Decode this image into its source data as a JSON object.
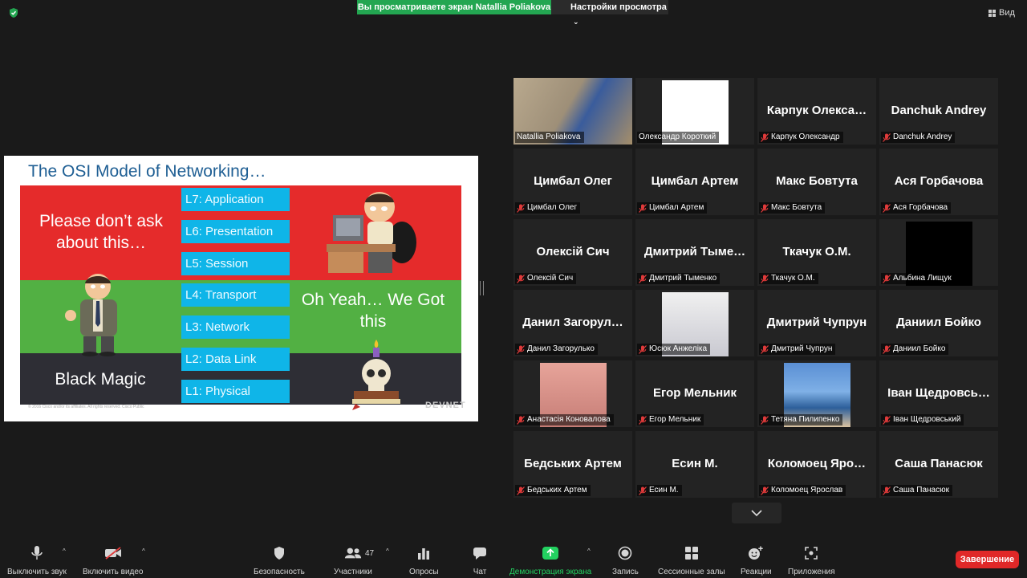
{
  "topbar": {
    "share_banner": "Вы просматриваете экран Natallia Poliakova",
    "view_settings": "Настройки просмотра",
    "view_button": "Вид"
  },
  "slide": {
    "title": "The OSI Model of Networking…",
    "ask_text": "Please don’t ask about this…",
    "yeah_text": "Oh Yeah… We Got this",
    "magic_text": "Black Magic",
    "layers": [
      "L7: Application",
      "L6: Presentation",
      "L5: Session",
      "L4: Transport",
      "L3: Network",
      "L2: Data Link",
      "L1: Physical"
    ],
    "footer": "© 2016 Cisco and/or its affiliates. All rights reserved. Cisco Public",
    "brand": "DEVNET"
  },
  "participants": [
    {
      "name": "",
      "label": "Natallia Poliakova",
      "muted": false,
      "image": "video",
      "active": true
    },
    {
      "name": "",
      "label": "Олександр Короткий",
      "muted": false,
      "image": "uni"
    },
    {
      "name": "Карпук Олекса…",
      "label": "Карпук Олександр",
      "muted": true
    },
    {
      "name": "Danchuk Andrey",
      "label": "Danchuk Andrey",
      "muted": true
    },
    {
      "name": "Цимбал Олег",
      "label": "Цимбал Олег",
      "muted": true
    },
    {
      "name": "Цимбал Артем",
      "label": "Цимбал Артем",
      "muted": true
    },
    {
      "name": "Макс Бовтута",
      "label": "Макс Бовтута",
      "muted": true
    },
    {
      "name": "Ася Горбачова",
      "label": "Ася Горбачова",
      "muted": true
    },
    {
      "name": "Олексій Сич",
      "label": "Олексій Сич",
      "muted": true
    },
    {
      "name": "Дмитрий Тыме…",
      "label": "Дмитрий Тыменко",
      "muted": true
    },
    {
      "name": "Ткачук О.М.",
      "label": "Ткачук О.М.",
      "muted": true
    },
    {
      "name": "",
      "label": "Альбина Лищук",
      "muted": true,
      "image": "black"
    },
    {
      "name": "Данил Загорул…",
      "label": "Данил Загорулько",
      "muted": true
    },
    {
      "name": "",
      "label": "Юсюк Анжеліка",
      "muted": true,
      "image": "anime"
    },
    {
      "name": "Дмитрий Чупрун",
      "label": "Дмитрий Чупрун",
      "muted": true
    },
    {
      "name": "Даниил Бойко",
      "label": "Даниил Бойко",
      "muted": true
    },
    {
      "name": "",
      "label": "Анастасія Коновалова",
      "muted": true,
      "image": "pink"
    },
    {
      "name": "Егор Мельник",
      "label": "Егор Мельник",
      "muted": true
    },
    {
      "name": "",
      "label": "Тетяна Пилипенко",
      "muted": true,
      "image": "beach"
    },
    {
      "name": "Іван Щедровсь…",
      "label": "Іван Щедровський",
      "muted": true
    },
    {
      "name": "Бедських Артем",
      "label": "Бедських Артем",
      "muted": true
    },
    {
      "name": "Есин М.",
      "label": "Есин М.",
      "muted": true
    },
    {
      "name": "Коломоец Яро…",
      "label": "Коломоец Ярослав",
      "muted": true
    },
    {
      "name": "Саша Панасюк",
      "label": "Саша Панасюк",
      "muted": true
    }
  ],
  "toolbar": {
    "mute": "Выключить звук",
    "video": "Включить видео",
    "security": "Безопасность",
    "participants": "Участники",
    "participants_count": "47",
    "polls": "Опросы",
    "chat": "Чат",
    "share": "Демонстрация экрана",
    "record": "Запись",
    "breakout": "Сессионные залы",
    "reactions": "Реакции",
    "apps": "Приложения",
    "end": "Завершение"
  },
  "colors": {
    "accent_green": "#23a651",
    "active_speaker": "#d3e35a",
    "end_red": "#e02828",
    "muted_red": "#e03a3a"
  }
}
